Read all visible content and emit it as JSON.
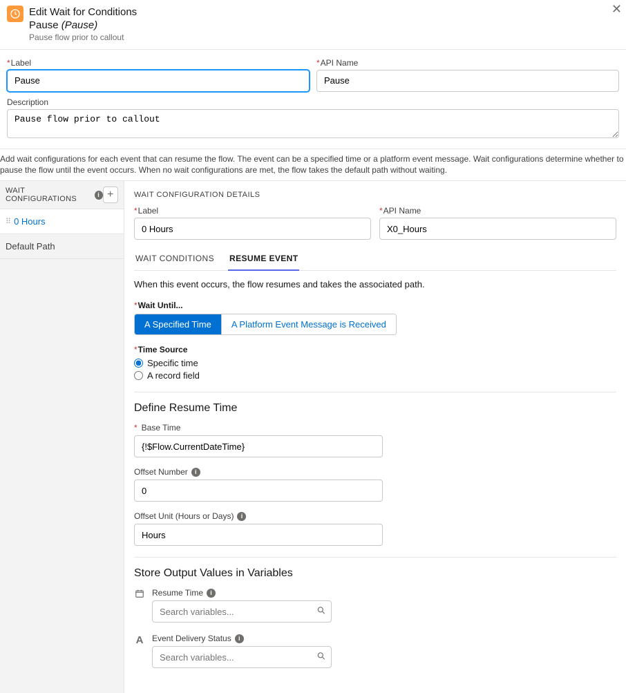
{
  "header": {
    "title": "Edit Wait for Conditions",
    "subtitle_prefix": "Pause",
    "subtitle_italic": "(Pause)",
    "desc": "Pause flow prior to callout"
  },
  "top_form": {
    "label_label": "Label",
    "label_value": "Pause",
    "api_label": "API Name",
    "api_value": "Pause",
    "desc_label": "Description",
    "desc_value": "Pause flow prior to callout"
  },
  "helper": "Add wait configurations for each event that can resume the flow. The event can be a specified time or a platform event message. Wait configurations determine whether to pause the flow until the event occurs. When no wait configurations are met, the flow takes the default path without waiting.",
  "side": {
    "header": "WAIT CONFIGURATIONS",
    "items": [
      "0 Hours"
    ],
    "default_label": "Default Path"
  },
  "details": {
    "title": "WAIT CONFIGURATION DETAILS",
    "label_label": "Label",
    "label_value": "0 Hours",
    "api_label": "API Name",
    "api_value": "X0_Hours"
  },
  "tabs": {
    "conditions": "WAIT CONDITIONS",
    "resume": "RESUME EVENT",
    "intro": "When this event occurs, the flow resumes and takes the associated path."
  },
  "wait_until": {
    "label": "Wait Until...",
    "opt1": "A Specified Time",
    "opt2": "A Platform Event Message is Received"
  },
  "time_source": {
    "label": "Time Source",
    "opt1": "Specific time",
    "opt2": "A record field"
  },
  "resume_time": {
    "heading": "Define Resume Time",
    "base_label": "Base Time",
    "base_value": "{!$Flow.CurrentDateTime}",
    "offset_num_label": "Offset Number",
    "offset_num_value": "0",
    "offset_unit_label": "Offset Unit (Hours or Days)",
    "offset_unit_value": "Hours"
  },
  "outputs": {
    "heading": "Store Output Values in Variables",
    "resume_label": "Resume Time",
    "delivery_label": "Event Delivery Status",
    "search_placeholder": "Search variables..."
  }
}
